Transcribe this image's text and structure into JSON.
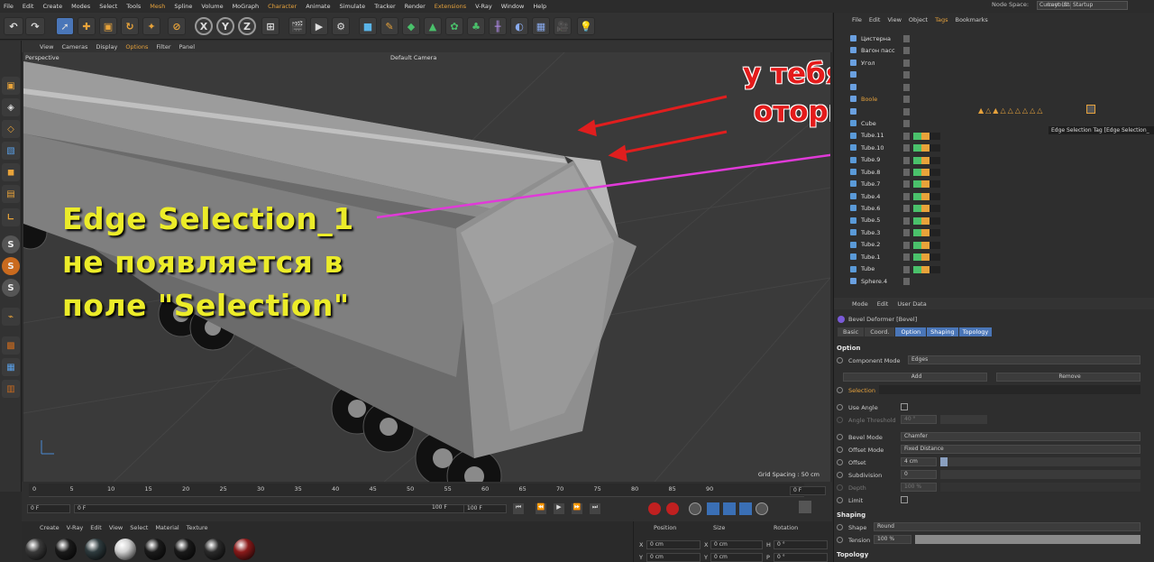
{
  "menubar": {
    "items": [
      "File",
      "Edit",
      "Create",
      "Modes",
      "Select",
      "Tools",
      "Mesh",
      "Spline",
      "Volume",
      "MoGraph",
      "Character",
      "Animate",
      "Simulate",
      "Tracker",
      "Render",
      "Extensions",
      "V-Ray",
      "Window",
      "Help"
    ],
    "node_space_label": "Node Space:",
    "node_space_value": "Current (Standard/Physical)",
    "layout_label": "Layout:",
    "layout_value": "Startup"
  },
  "viewport": {
    "menu": [
      "View",
      "Cameras",
      "Display",
      "Options",
      "Filter",
      "Panel"
    ],
    "perspective": "Perspective",
    "camera": "Default Camera",
    "grid_spacing": "Grid Spacing : 50 cm"
  },
  "annotations": {
    "red_line1": "у тебя крышка",
    "red_line2": "оторвалась!!!",
    "yellow_line1": "Edge Selection_1",
    "yellow_line2": "не появляется в",
    "yellow_line3": "поле \"Selection\""
  },
  "object_manager": {
    "menu": [
      "File",
      "Edit",
      "View",
      "Object",
      "Tags",
      "Bookmarks"
    ],
    "tooltip": "Edge Selection Tag [Edge Selection_",
    "objects": [
      "Цистерна",
      "Вагон пасс",
      "Угол",
      "",
      "",
      "Boole",
      "",
      "Cube",
      "Tube.11",
      "Tube.10",
      "Tube.9",
      "Tube.8",
      "Tube.7",
      "Tube.4",
      "Tube.6",
      "Tube.5",
      "Tube.3",
      "Tube.2",
      "Tube.1",
      "Tube",
      "Sphere.4"
    ]
  },
  "attributes": {
    "menu": [
      "Mode",
      "Edit",
      "User Data"
    ],
    "object_title": "Bevel Deformer [Bevel]",
    "tabs": [
      "Basic",
      "Coord.",
      "Option",
      "Shaping",
      "Topology"
    ],
    "section_option": "Option",
    "component_mode_label": "Component Mode",
    "component_mode_value": "Edges",
    "add_label": "Add",
    "remove_label": "Remove",
    "selection_label": "Selection",
    "use_angle_label": "Use Angle",
    "angle_threshold_label": "Angle Threshold",
    "angle_threshold_value": "40 °",
    "bevel_mode_label": "Bevel Mode",
    "bevel_mode_value": "Chamfer",
    "offset_mode_label": "Offset Mode",
    "offset_mode_value": "Fixed Distance",
    "offset_label": "Offset",
    "offset_value": "4 cm",
    "subdivision_label": "Subdivision",
    "subdivision_value": "0",
    "depth_label": "Depth",
    "depth_value": "100 %",
    "limit_label": "Limit",
    "section_shaping": "Shaping",
    "shape_label": "Shape",
    "shape_value": "Round",
    "tension_label": "Tension",
    "tension_value": "100 %",
    "section_topology": "Topology"
  },
  "timeline": {
    "ticks": [
      "0",
      "5",
      "10",
      "15",
      "20",
      "25",
      "30",
      "35",
      "40",
      "45",
      "50",
      "55",
      "60",
      "65",
      "70",
      "75",
      "80",
      "85",
      "90"
    ],
    "frame_start": "0 F",
    "frame_a": "0 F",
    "frame_end": "100 F",
    "frame_end2": "100 F",
    "frame_current": "0 F"
  },
  "materials_bar": {
    "menu": [
      "Create",
      "V-Ray",
      "Edit",
      "View",
      "Select",
      "Material",
      "Texture"
    ],
    "colors": [
      "#3a3a3a",
      "#1a1a1a",
      "#2e3b3e",
      "#d0d0d0",
      "#1b1b1b",
      "#1a1a1a",
      "#2a2a2a",
      "#8b1a1a"
    ]
  },
  "coords": {
    "headers": [
      "Position",
      "Size",
      "Rotation"
    ],
    "x": [
      "X",
      "0 cm",
      "X",
      "0 cm",
      "H",
      "0 °"
    ],
    "y": [
      "Y",
      "0 cm",
      "Y",
      "0 cm",
      "P",
      "0 °"
    ]
  }
}
